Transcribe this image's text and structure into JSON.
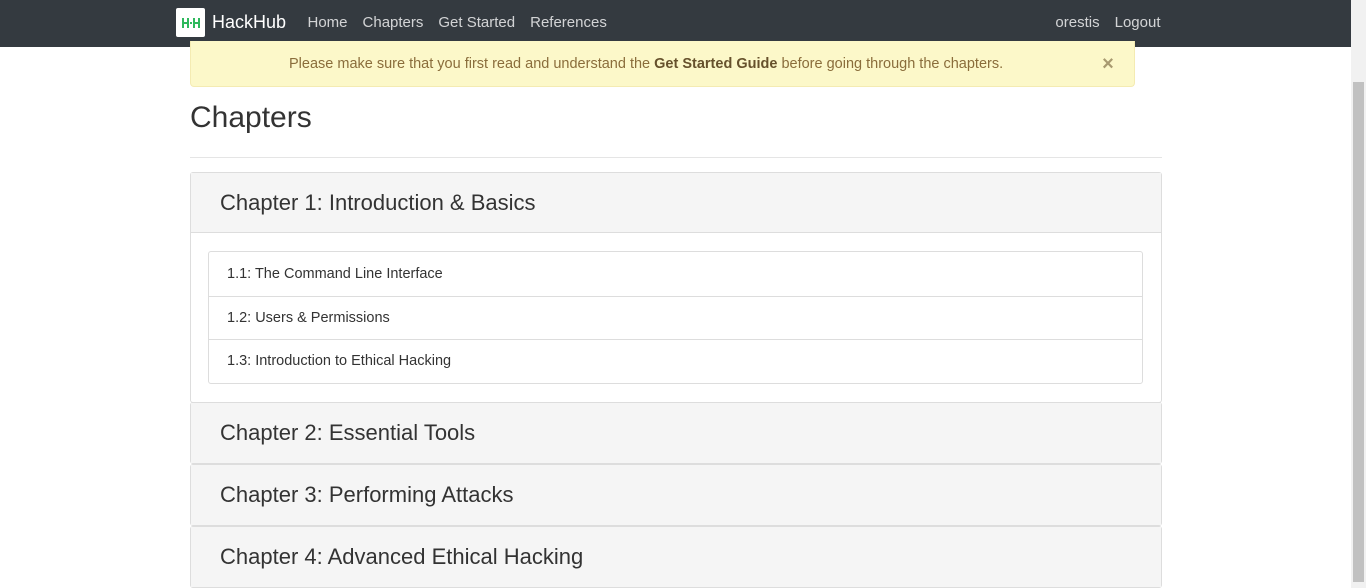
{
  "navbar": {
    "brand": "HackHub",
    "logo_icon": "hackhub-logo",
    "links": [
      "Home",
      "Chapters",
      "Get Started",
      "References"
    ],
    "user": "orestis",
    "logout": "Logout",
    "background": "#343a40"
  },
  "alert": {
    "prefix": "Please make sure that you first read and understand the ",
    "link": "Get Started Guide",
    "suffix": " before going through the chapters.",
    "close": "×",
    "background": "#fcf8c9",
    "color": "#8a6d3b"
  },
  "page_title": "Chapters",
  "chapters": [
    {
      "title": "Chapter 1: Introduction & Basics",
      "expanded": true,
      "items": [
        "1.1: The Command Line Interface",
        "1.2: Users & Permissions",
        "1.3: Introduction to Ethical Hacking"
      ]
    },
    {
      "title": "Chapter 2: Essential Tools",
      "expanded": false
    },
    {
      "title": "Chapter 3: Performing Attacks",
      "expanded": false
    },
    {
      "title": "Chapter 4: Advanced Ethical Hacking",
      "expanded": false
    }
  ]
}
